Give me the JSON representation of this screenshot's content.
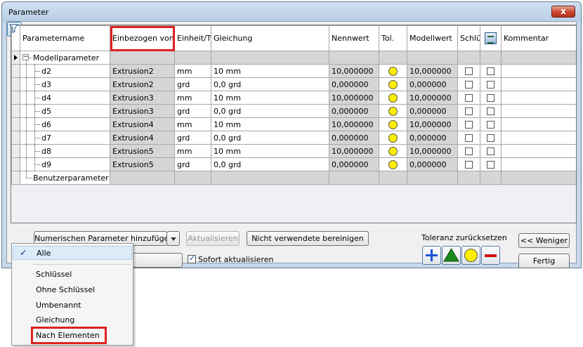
{
  "window": {
    "title": "Parameter",
    "close_label": "x"
  },
  "table": {
    "headers": {
      "name": "Parametername",
      "consumed_by": "Einbezogen von",
      "unit": "Einheit/Ty",
      "equation": "Gleichung",
      "nominal": "Nennwert",
      "tol": "Tol.",
      "model_value": "Modellwert",
      "key": "Schlü",
      "comment": "Kommentar"
    },
    "group_model": "Modellparameter",
    "group_user": "Benutzerparameter",
    "rows": [
      {
        "name": "d2",
        "consumed_by": "Extrusion2",
        "unit": "mm",
        "equation": "10 mm",
        "nominal": "10,000000",
        "model_value": "10,000000"
      },
      {
        "name": "d3",
        "consumed_by": "Extrusion2",
        "unit": "grd",
        "equation": "0,0 grd",
        "nominal": "0,000000",
        "model_value": "0,000000"
      },
      {
        "name": "d4",
        "consumed_by": "Extrusion3",
        "unit": "mm",
        "equation": "10 mm",
        "nominal": "10,000000",
        "model_value": "10,000000"
      },
      {
        "name": "d5",
        "consumed_by": "Extrusion3",
        "unit": "grd",
        "equation": "0,0 grd",
        "nominal": "0,000000",
        "model_value": "0,000000"
      },
      {
        "name": "d6",
        "consumed_by": "Extrusion4",
        "unit": "mm",
        "equation": "10 mm",
        "nominal": "10,000000",
        "model_value": "10,000000"
      },
      {
        "name": "d7",
        "consumed_by": "Extrusion4",
        "unit": "grd",
        "equation": "0,0 grd",
        "nominal": "0,000000",
        "model_value": "0,000000"
      },
      {
        "name": "d8",
        "consumed_by": "Extrusion5",
        "unit": "mm",
        "equation": "10 mm",
        "nominal": "10,000000",
        "model_value": "10,000000"
      },
      {
        "name": "d9",
        "consumed_by": "Extrusion5",
        "unit": "grd",
        "equation": "0,0 grd",
        "nominal": "0,000000",
        "model_value": "0,000000"
      }
    ]
  },
  "toolbar": {
    "add_numeric": "Numerischen Parameter hinzufügen",
    "update": "Aktualisieren",
    "purge_unused": "Nicht verwendete bereinigen",
    "immediate_update": "Sofort aktualisieren",
    "reset_tolerance": "Toleranz zurücksetzen",
    "less": "<< Weniger",
    "done": "Fertig"
  },
  "filter_menu": {
    "selected": "Alle",
    "items": [
      "Schlüssel",
      "Ohne Schlüssel",
      "Umbenannt",
      "Gleichung",
      "Nach Elementen"
    ]
  },
  "colors": {
    "highlight_red": "#e02020",
    "tolerance_yellow": "#ffee00",
    "plus_blue": "#1b4fd8",
    "triangle_green": "#1a8a1a",
    "minus_red": "#d01010"
  }
}
